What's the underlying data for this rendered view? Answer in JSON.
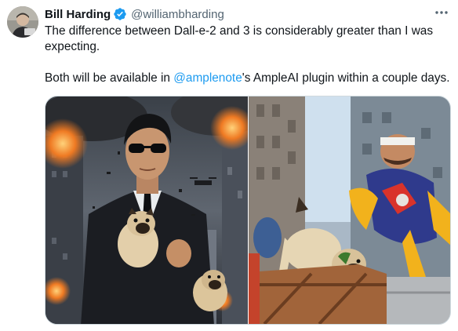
{
  "author": {
    "display_name": "Bill Harding",
    "handle": "@williambharding",
    "verified": true,
    "avatar_alt": "avatar"
  },
  "tweet": {
    "line1": "The difference between Dall-e-2 and 3 is considerably greater than I was expecting.",
    "line2_prefix": "Both will be available in ",
    "line2_mention": "@amplenote",
    "line2_suffix": "'s AmpleAI plugin within a couple days."
  },
  "media": [
    {
      "label": "Dall-e-3 image",
      "icon": "image-man-with-pugs"
    },
    {
      "label": "Dall-e-2 image",
      "icon": "image-pug-and-hero"
    }
  ],
  "colors": {
    "text": "#0f1419",
    "secondary": "#536471",
    "link": "#1d9bf0",
    "border": "#cfd9de",
    "verified": "#1d9bf0"
  }
}
